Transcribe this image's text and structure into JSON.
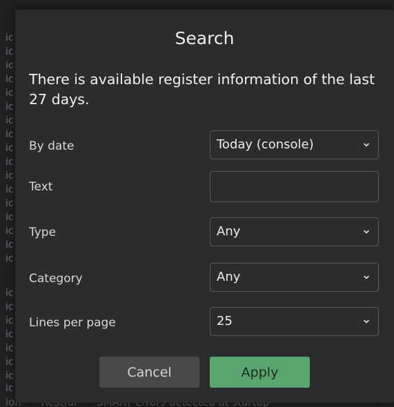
{
  "background": {
    "row_fragment": "ic",
    "bottom_line": [
      "ion",
      "Restful",
      "SMART errors detected at startup"
    ]
  },
  "dialog": {
    "title": "Search",
    "info": "There is available register information of the last 27 days.",
    "fields": {
      "by_date": {
        "label": "By date",
        "value": "Today (console)"
      },
      "text": {
        "label": "Text",
        "value": "",
        "placeholder": ""
      },
      "type": {
        "label": "Type",
        "value": "Any"
      },
      "category": {
        "label": "Category",
        "value": "Any"
      },
      "lines_per_page": {
        "label": "Lines per page",
        "value": "25"
      }
    },
    "buttons": {
      "cancel": "Cancel",
      "apply": "Apply"
    },
    "icons": {
      "select_chevron": "chevron-down-icon"
    },
    "colors": {
      "dialog_bg": "#2b2c2e",
      "apply_bg": "#5aa56d",
      "cancel_bg": "#48494b"
    }
  }
}
